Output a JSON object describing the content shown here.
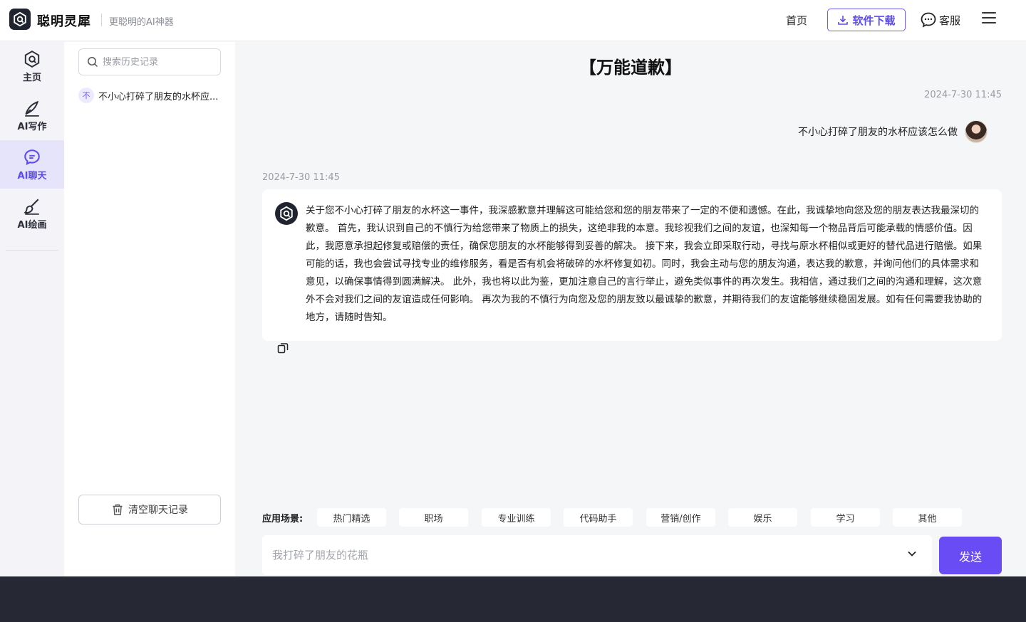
{
  "header": {
    "brand": "聪明灵犀",
    "slogan": "更聪明的AI神器",
    "nav_home": "首页",
    "download_label": "软件下载",
    "service_label": "客服"
  },
  "rail": {
    "items": [
      {
        "label": "主页",
        "icon": "hexagon-logo-icon"
      },
      {
        "label": "AI写作",
        "icon": "pen-icon"
      },
      {
        "label": "AI聊天",
        "icon": "chat-bubble-icon",
        "active": true
      },
      {
        "label": "AI绘画",
        "icon": "brush-icon"
      }
    ]
  },
  "history": {
    "search_placeholder": "搜索历史记录",
    "items": [
      {
        "badge": "不",
        "text": "不小心打碎了朋友的水杯应..."
      }
    ],
    "clear_label": "清空聊天记录"
  },
  "chat": {
    "title": "【万能道歉】",
    "user_time": "2024-7-30 11:45",
    "user_message": "不小心打碎了朋友的水杯应该怎么做",
    "ai_time": "2024-7-30 11:45",
    "ai_message": "关于您不小心打碎了朋友的水杯这一事件，我深感歉意并理解这可能给您和您的朋友带来了一定的不便和遗憾。在此，我诚挚地向您及您的朋友表达我最深切的歉意。 首先，我认识到自己的不慎行为给您带来了物质上的损失，这绝非我的本意。我珍视我们之间的友谊，也深知每一个物品背后可能承载的情感价值。因此，我愿意承担起修复或赔偿的责任，确保您朋友的水杯能够得到妥善的解决。 接下来，我会立即采取行动，寻找与原水杯相似或更好的替代品进行赔偿。如果可能的话，我也会尝试寻找专业的维修服务，看是否有机会将破碎的水杯修复如初。同时，我会主动与您的朋友沟通，表达我的歉意，并询问他们的具体需求和意见，以确保事情得到圆满解决。 此外，我也将以此为鉴，更加注意自己的言行举止，避免类似事件的再次发生。我相信，通过我们之间的沟通和理解，这次意外不会对我们之间的友谊造成任何影响。 再次为我的不慎行为向您及您的朋友致以最诚挚的歉意，并期待我们的友谊能够继续稳固发展。如有任何需要我协助的地方，请随时告知。"
  },
  "scenes": {
    "label": "应用场景:",
    "chips": [
      "热门精选",
      "职场",
      "专业训练",
      "代码助手",
      "营销/创作",
      "娱乐",
      "学习",
      "其他"
    ]
  },
  "composer": {
    "placeholder": "我打碎了朋友的花瓶",
    "send_label": "发送"
  },
  "colors": {
    "accent": "#6a4cf5",
    "logo_bg": "#1f2430",
    "footer": "#262833"
  }
}
